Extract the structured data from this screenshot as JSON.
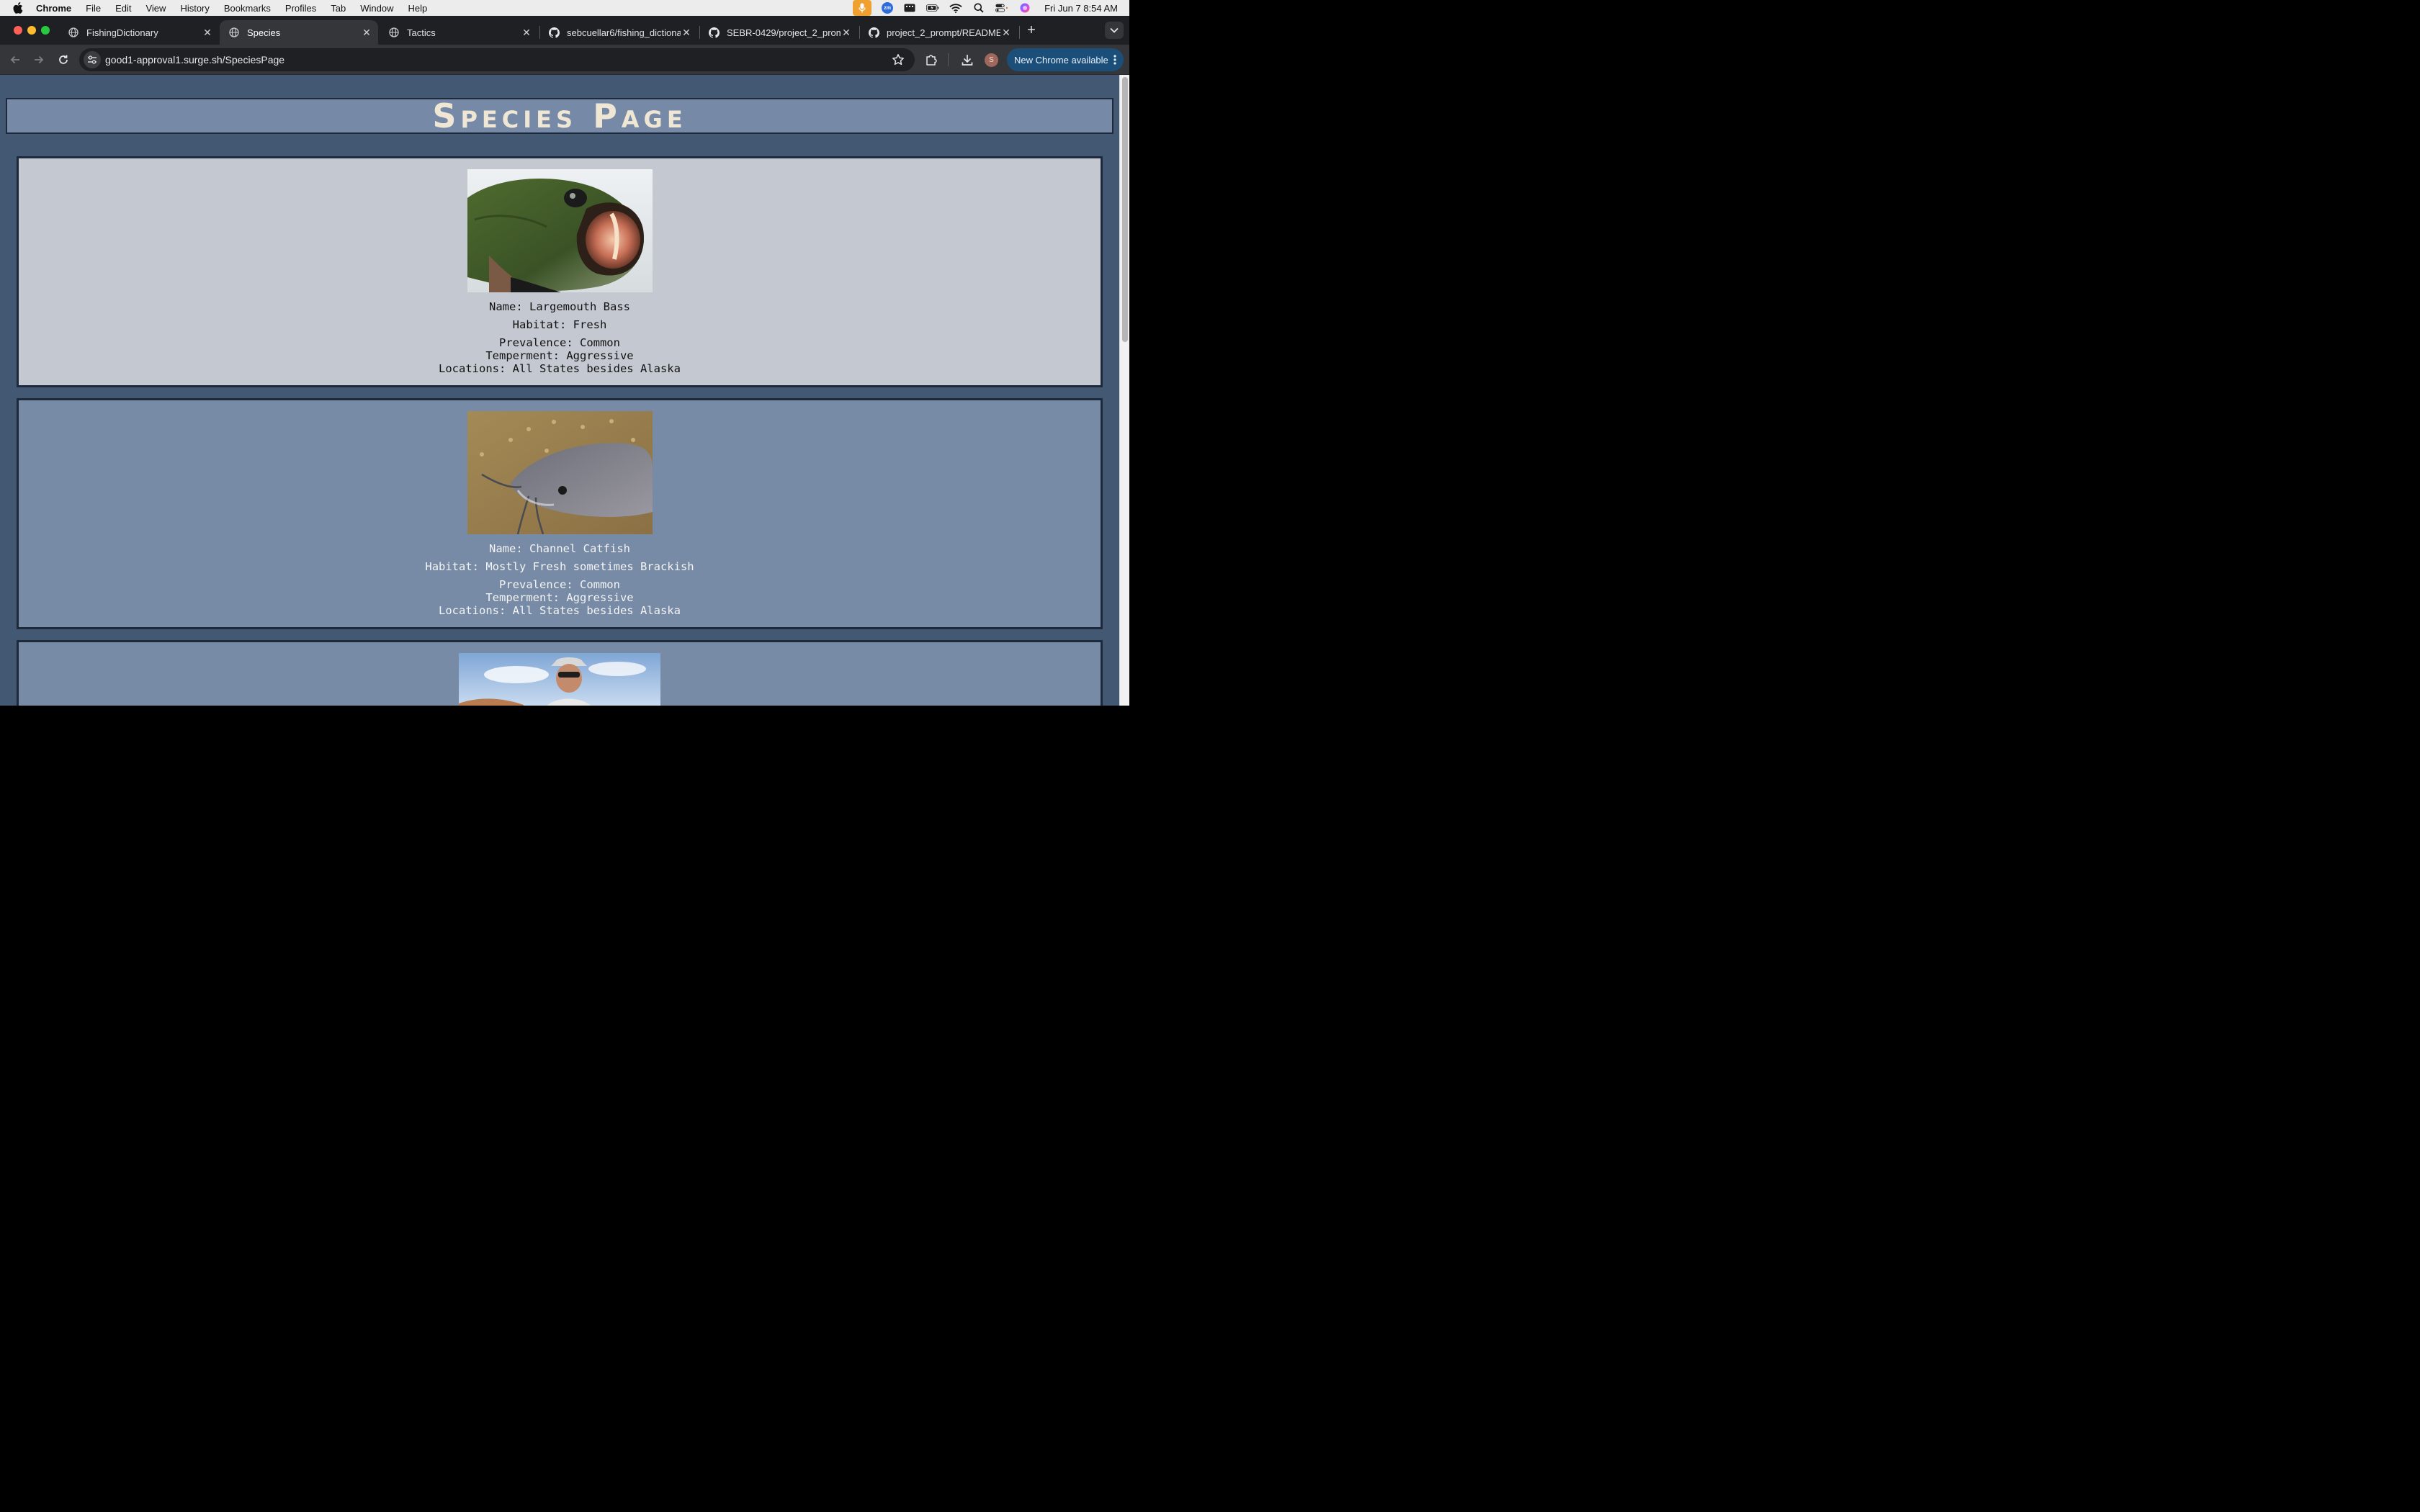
{
  "menubar": {
    "app_name": "Chrome",
    "items": [
      "File",
      "Edit",
      "View",
      "History",
      "Bookmarks",
      "Profiles",
      "Tab",
      "Window",
      "Help"
    ],
    "clock": "Fri Jun 7  8:54 AM",
    "zoom_label": "zm"
  },
  "tabs": [
    {
      "title": "FishingDictionary",
      "icon": "globe-icon"
    },
    {
      "title": "Species",
      "icon": "globe-icon",
      "active": true
    },
    {
      "title": "Tactics",
      "icon": "globe-icon"
    },
    {
      "title": "sebcuellar6/fishing_dictionary",
      "icon": "github-icon"
    },
    {
      "title": "SEBR-0429/project_2_prompt",
      "icon": "github-icon"
    },
    {
      "title": "project_2_prompt/README.md",
      "icon": "github-icon"
    }
  ],
  "toolbar": {
    "url": "good1-approval1.surge.sh/SpeciesPage",
    "profile_initial": "S",
    "update_label": "New Chrome available"
  },
  "page": {
    "title": "Species Page",
    "species": [
      {
        "name": "Name: Largemouth Bass",
        "habitat": "Habitat: Fresh",
        "prevalence": "Prevalence: Common",
        "temperament": "Temperment: Aggressive",
        "locations": "Locations: All States besides Alaska"
      },
      {
        "name": "Name: Channel Catfish",
        "habitat": "Habitat: Mostly Fresh sometimes Brackish",
        "prevalence": "Prevalence: Common",
        "temperament": "Temperment: Aggressive",
        "locations": "Locations: All States besides Alaska"
      }
    ]
  },
  "colors": {
    "page_bg": "#435873",
    "header_bg": "#7689a7",
    "card_light_bg": "#c4c8d0",
    "card_blue_bg": "#778ba7",
    "border": "#1e2a3c",
    "title_text": "#f0e6d4"
  }
}
